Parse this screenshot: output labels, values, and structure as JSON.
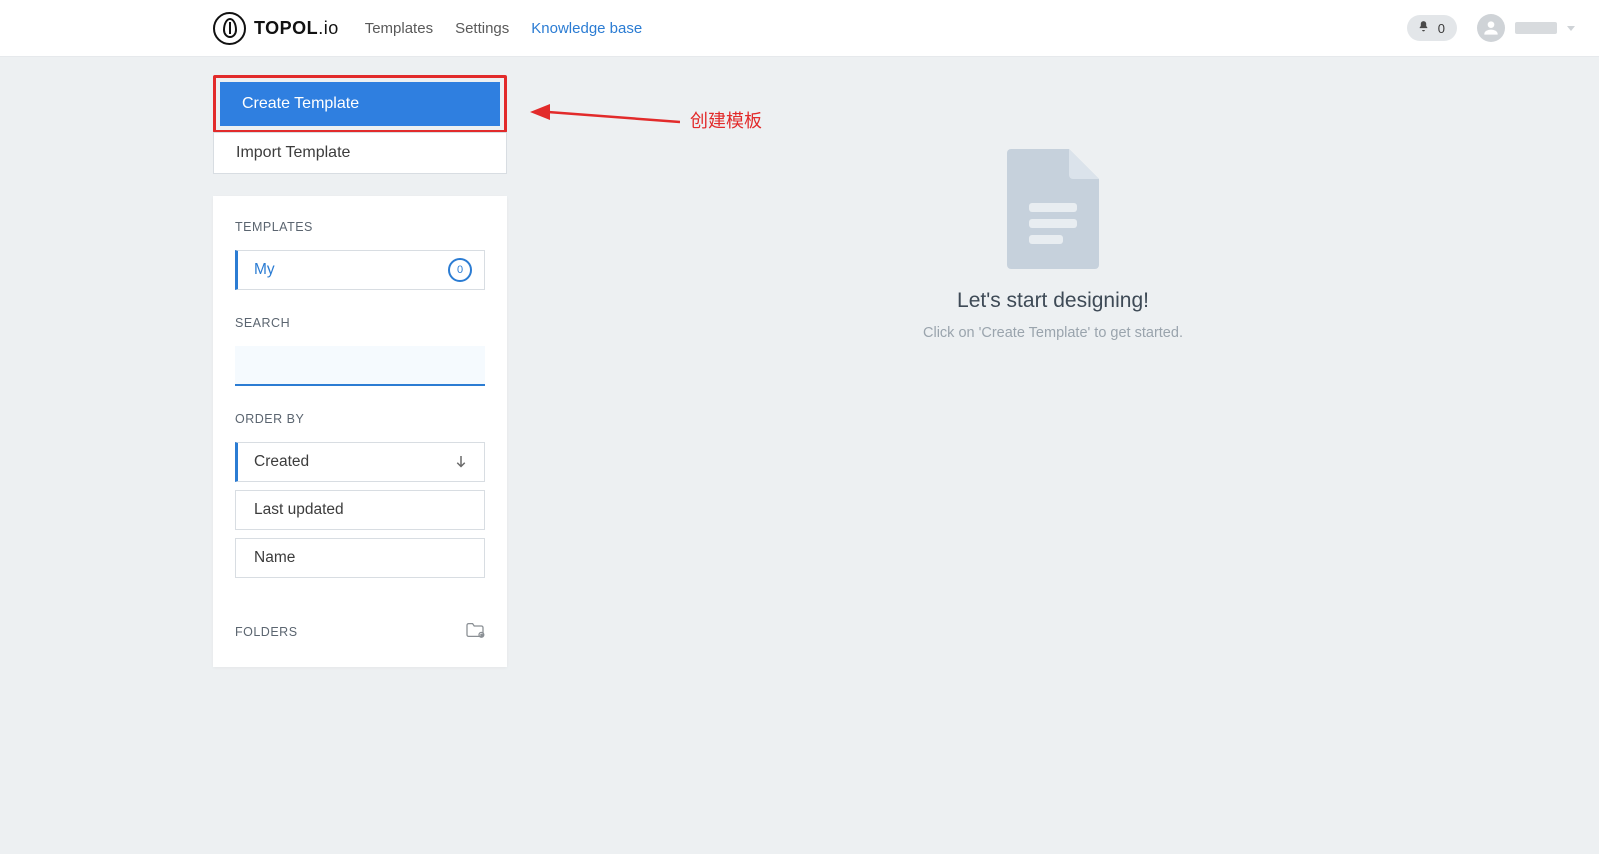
{
  "header": {
    "brand_main": "TOPOL",
    "brand_suffix": ".io",
    "nav": {
      "templates": "Templates",
      "settings": "Settings",
      "knowledge_base": "Knowledge base"
    },
    "notification_count": "0"
  },
  "actions": {
    "create_template": "Create Template",
    "import_template": "Import Template"
  },
  "sidebar": {
    "templates_label": "TEMPLATES",
    "template_filters": {
      "my": {
        "label": "My",
        "count": "0"
      }
    },
    "search_label": "SEARCH",
    "search_value": "",
    "order_by_label": "ORDER BY",
    "order_options": {
      "created": "Created",
      "last_updated": "Last updated",
      "name": "Name"
    },
    "folders_label": "FOLDERS"
  },
  "empty_state": {
    "title": "Let's start designing!",
    "subtitle": "Click on 'Create Template' to get started."
  },
  "annotation": {
    "text": "创建模板"
  }
}
